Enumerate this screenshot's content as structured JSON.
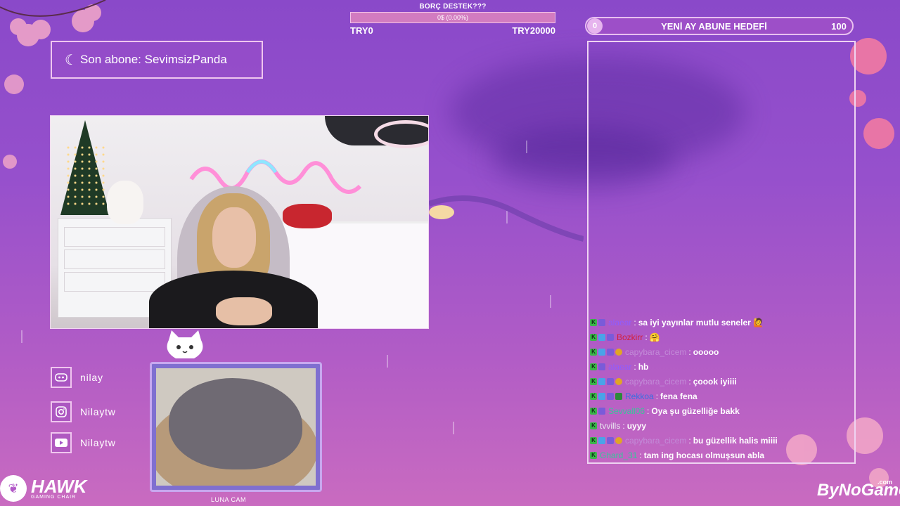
{
  "donation": {
    "title": "BORÇ DESTEK???",
    "progress_text": "0$ (0.00%)",
    "progress_fraction": 0.0,
    "min_label": "TRY0",
    "max_label": "TRY20000"
  },
  "sub_goal": {
    "current": "0",
    "label": "YENİ AY ABUNE HEDEFİ",
    "target": "100"
  },
  "last_subscriber": {
    "text": "Son abone: SevimsizPanda"
  },
  "socials": [
    {
      "icon": "discord-icon",
      "handle": "nilay"
    },
    {
      "icon": "instagram-icon",
      "handle": "Nilaytw"
    },
    {
      "icon": "youtube-icon",
      "handle": "Nilaytw"
    }
  ],
  "cat_cam": {
    "label": "LUNA CAM"
  },
  "chat": {
    "messages": [
      {
        "user": "alaear",
        "color": "#8f5cff",
        "badges": [
          "k",
          "n"
        ],
        "text": "sa iyi yayınlar mutlu seneler 🙋"
      },
      {
        "user": "Bozkirr",
        "color": "#d21f3c",
        "badges": [
          "k",
          "blue",
          "n"
        ],
        "text": "🤗"
      },
      {
        "user": "capybara_cicem",
        "color": "#c38bd8",
        "badges": [
          "k",
          "blue",
          "n",
          "gold"
        ],
        "text": "ooooo"
      },
      {
        "user": "alaear",
        "color": "#8f5cff",
        "badges": [
          "k",
          "n"
        ],
        "text": "hb"
      },
      {
        "user": "capybara_cicem",
        "color": "#c38bd8",
        "badges": [
          "k",
          "blue",
          "n",
          "gold"
        ],
        "text": "çoook iyiiii"
      },
      {
        "user": "Rekkoa",
        "color": "#3b6ee0",
        "badges": [
          "k",
          "blue",
          "n",
          "mod"
        ],
        "text": "fena fena"
      },
      {
        "user": "Sevvall06",
        "color": "#36c79a",
        "badges": [
          "k",
          "n"
        ],
        "text": "Oya şu güzelliğe bakk"
      },
      {
        "user": "tvvills",
        "color": "#e8e8f0",
        "badges": [
          "k"
        ],
        "text": "uyyy"
      },
      {
        "user": "capybara_cicem",
        "color": "#c38bd8",
        "badges": [
          "k",
          "blue",
          "n",
          "gold"
        ],
        "text": "bu güzellik halis miiii"
      },
      {
        "user": "Ghard_31",
        "color": "#36c79a",
        "badges": [
          "k"
        ],
        "text": "tam ing hocası olmuşsun abla"
      }
    ]
  },
  "sponsors": {
    "hawk_name": "HAWK",
    "hawk_sub": "GAMING CHAIR",
    "bynogame": "ByNoGame",
    "bynogame_suffix": ".com"
  }
}
